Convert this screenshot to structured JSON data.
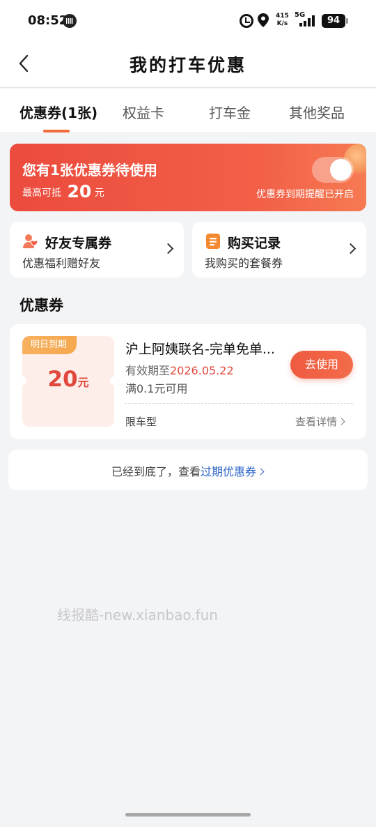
{
  "status_bar": {
    "time": "08:52",
    "net_speed_value": "415",
    "net_speed_unit": "K/s",
    "network_type": "5G",
    "battery": "94"
  },
  "nav": {
    "title": "我的打车优惠",
    "back_icon": "chevron-left-icon"
  },
  "tabs": [
    {
      "label": "优惠券(1张)",
      "active": true
    },
    {
      "label": "权益卡",
      "active": false
    },
    {
      "label": "打车金",
      "active": false
    },
    {
      "label": "其他奖品",
      "active": false
    }
  ],
  "banner": {
    "title": "您有1张优惠券待使用",
    "sub_prefix": "最高可抵",
    "amount": "20",
    "unit": "元",
    "reminder_note": "优惠券到期提醒已开启",
    "reminder_on": true
  },
  "entries": [
    {
      "icon": "friend-heart-icon",
      "title": "好友专属券",
      "subtitle": "优惠福利赠好友"
    },
    {
      "icon": "record-list-icon",
      "title": "购买记录",
      "subtitle": "我购买的套餐券"
    }
  ],
  "section": {
    "title": "优惠券"
  },
  "coupon": {
    "badge": "明日到期",
    "amount": "20",
    "unit": "元",
    "name": "沪上阿姨联名-完单免单...",
    "valid_prefix": "有效期至",
    "valid_date": "2026.05.22",
    "condition": "满0.1元可用",
    "use_button": "去使用",
    "limit": "限车型",
    "detail_link": "查看详情"
  },
  "footer": {
    "text": "已经到底了，查看",
    "link": "过期优惠券"
  },
  "watermark": "线报酷-new.xianbao.fun",
  "colors": {
    "accent": "#f06a3a",
    "banner_start": "#ec4b3d",
    "banner_end": "#f67a52",
    "coupon_red": "#e0483c",
    "link_blue": "#2b63c5",
    "badge_orange": "#f5a84e"
  }
}
